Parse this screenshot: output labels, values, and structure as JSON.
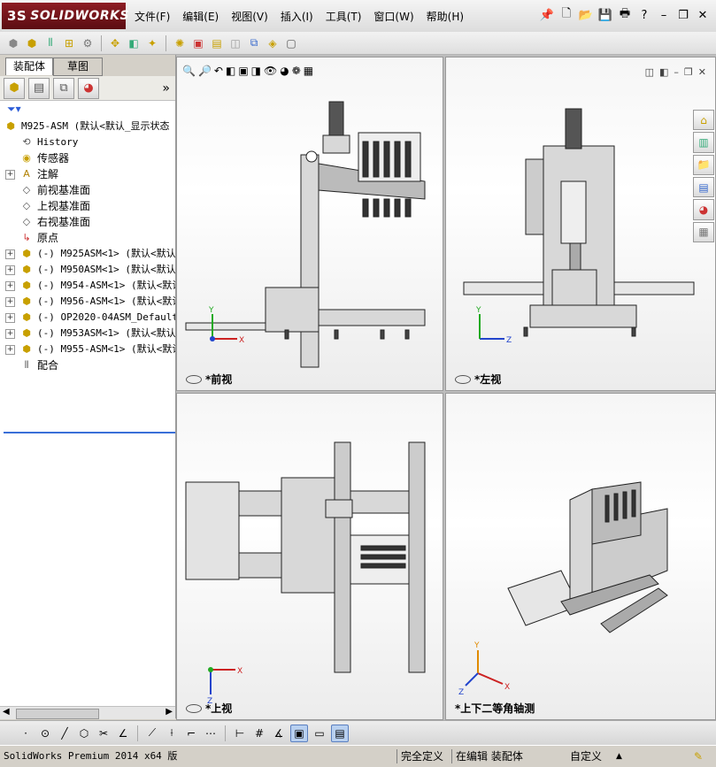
{
  "app": {
    "brand": "SOLIDWORKS",
    "brand_mark": "3S"
  },
  "menu": [
    "文件(F)",
    "编辑(E)",
    "视图(V)",
    "插入(I)",
    "工具(T)",
    "窗口(W)",
    "帮助(H)"
  ],
  "panel": {
    "tabs": [
      "装配体",
      "草图"
    ],
    "tree": [
      {
        "label": "M925-ASM  (默认<默认_显示状态",
        "icon": "assembly-icon",
        "expandable": false,
        "level": 0
      },
      {
        "label": "History",
        "icon": "history-icon",
        "expandable": false,
        "level": 1
      },
      {
        "label": "传感器",
        "icon": "sensor-icon",
        "expandable": false,
        "level": 1
      },
      {
        "label": "注解",
        "icon": "annotation-icon",
        "expandable": true,
        "level": 1
      },
      {
        "label": "前视基准面",
        "icon": "plane-icon",
        "expandable": false,
        "level": 1
      },
      {
        "label": "上视基准面",
        "icon": "plane-icon",
        "expandable": false,
        "level": 1
      },
      {
        "label": "右视基准面",
        "icon": "plane-icon",
        "expandable": false,
        "level": 1
      },
      {
        "label": "原点",
        "icon": "origin-icon",
        "expandable": false,
        "level": 1
      },
      {
        "label": "(-) M925ASM<1> (默认<默认_",
        "icon": "subassembly-icon",
        "expandable": true,
        "level": 1
      },
      {
        "label": "(-) M950ASM<1> (默认<默认_",
        "icon": "subassembly-icon",
        "expandable": true,
        "level": 1
      },
      {
        "label": "(-) M954-ASM<1> (默认<默认",
        "icon": "subassembly-icon",
        "expandable": true,
        "level": 1
      },
      {
        "label": "(-) M956-ASM<1> (默认<默认",
        "icon": "subassembly-icon",
        "expandable": true,
        "level": 1
      },
      {
        "label": "(-) OP2020-04ASM_Default<",
        "icon": "subassembly-icon",
        "expandable": true,
        "level": 1
      },
      {
        "label": "(-) M953ASM<1> (默认<默认_",
        "icon": "subassembly-icon",
        "expandable": true,
        "level": 1
      },
      {
        "label": "(-) M955-ASM<1> (默认<默认",
        "icon": "subassembly-icon",
        "expandable": true,
        "level": 1
      },
      {
        "label": "配合",
        "icon": "mates-icon",
        "expandable": false,
        "level": 1
      }
    ]
  },
  "viewports": [
    {
      "label": "*前视",
      "axes": [
        "Y",
        "X"
      ]
    },
    {
      "label": "*左视",
      "axes": [
        "Y",
        "Z"
      ]
    },
    {
      "label": "*上视",
      "axes": [
        "X",
        "Z"
      ]
    },
    {
      "label": "*上下二等角轴测",
      "axes": [
        "Y",
        "X",
        "Z"
      ]
    }
  ],
  "status": {
    "product": "SolidWorks Premium 2014 x64 版",
    "definition": "完全定义",
    "editing": "在编辑 装配体",
    "units": "自定义",
    "units_arrow": "▲"
  },
  "colors": {
    "brand": "#8d1d24",
    "accent": "#3a6fd8",
    "axis_x": "#cc2222",
    "axis_y": "#22aa22",
    "axis_z": "#2244cc"
  }
}
